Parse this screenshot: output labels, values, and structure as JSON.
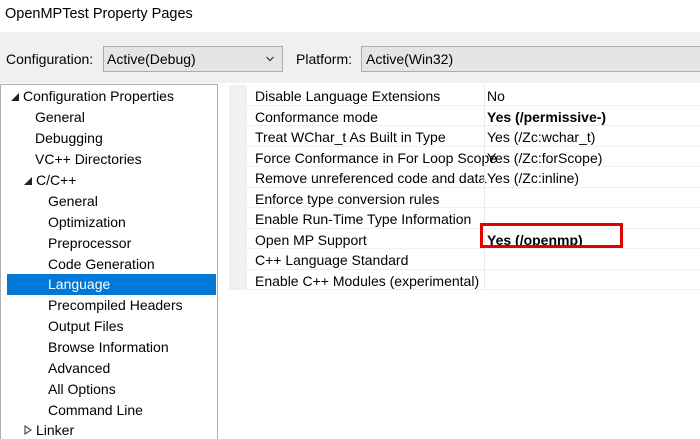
{
  "window": {
    "title": "OpenMPTest Property Pages"
  },
  "config": {
    "configuration_label": "Configuration:",
    "configuration_value": "Active(Debug)",
    "platform_label": "Platform:",
    "platform_value": "Active(Win32)"
  },
  "tree": {
    "items": [
      {
        "label": "Configuration Properties",
        "expanded": true
      },
      {
        "label": "General"
      },
      {
        "label": "Debugging"
      },
      {
        "label": "VC++ Directories"
      },
      {
        "label": "C/C++",
        "expanded": true
      },
      {
        "label": "General"
      },
      {
        "label": "Optimization"
      },
      {
        "label": "Preprocessor"
      },
      {
        "label": "Code Generation"
      },
      {
        "label": "Language",
        "selected": true
      },
      {
        "label": "Precompiled Headers"
      },
      {
        "label": "Output Files"
      },
      {
        "label": "Browse Information"
      },
      {
        "label": "Advanced"
      },
      {
        "label": "All Options"
      },
      {
        "label": "Command Line"
      },
      {
        "label": "Linker",
        "expanded": false
      }
    ]
  },
  "grid": {
    "rows": [
      {
        "name": "Disable Language Extensions",
        "value": "No"
      },
      {
        "name": "Conformance mode",
        "value": "Yes (/permissive-)",
        "bold": true
      },
      {
        "name": "Treat WChar_t As Built in Type",
        "value": "Yes (/Zc:wchar_t)"
      },
      {
        "name": "Force Conformance in For Loop Scope",
        "value": "Yes (/Zc:forScope)"
      },
      {
        "name": "Remove unreferenced code and data",
        "value": "Yes (/Zc:inline)"
      },
      {
        "name": "Enforce type conversion rules",
        "value": ""
      },
      {
        "name": "Enable Run-Time Type Information",
        "value": ""
      },
      {
        "name": "Open MP Support",
        "value": "Yes (/openmp)",
        "bold": true,
        "highlighted": true
      },
      {
        "name": "C++ Language Standard",
        "value": ""
      },
      {
        "name": "Enable C++ Modules (experimental)",
        "value": ""
      }
    ]
  },
  "colors": {
    "selection": "#0078d7",
    "highlight_box": "#e50000",
    "panel_bg": "#f0f0f0",
    "combo_bg": "#e5e5e5"
  }
}
